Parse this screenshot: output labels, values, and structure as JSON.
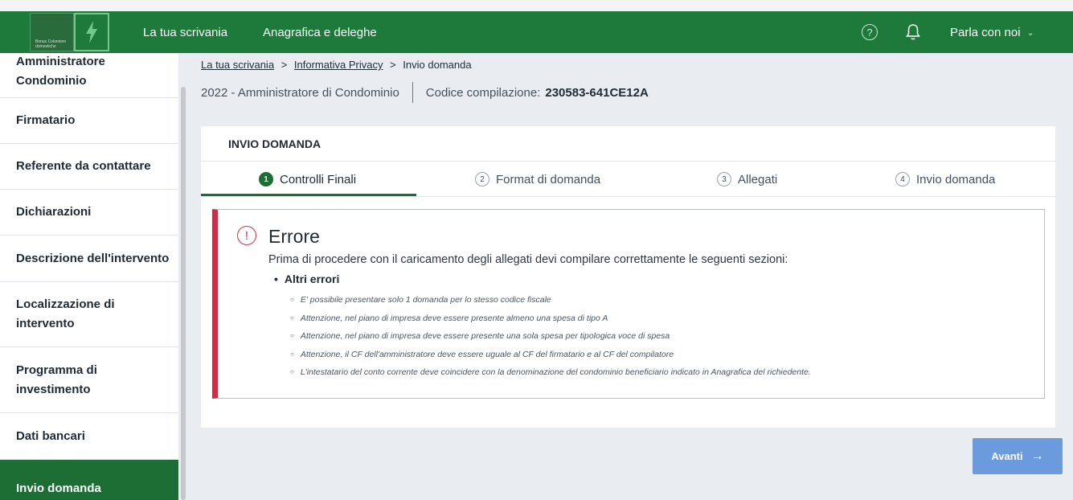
{
  "header": {
    "logo_text": "Bonus Colonnine domestiche",
    "nav": [
      "La tua scrivania",
      "Anagrafica e deleghe"
    ],
    "help_glyph": "?",
    "chat_label": "Parla con noi",
    "chat_chevron": "⌄"
  },
  "sidebar": {
    "items": [
      {
        "label": "Amministratore Condominio",
        "active": false
      },
      {
        "label": "Firmatario",
        "active": false
      },
      {
        "label": "Referente da contattare",
        "active": false
      },
      {
        "label": "Dichiarazioni",
        "active": false
      },
      {
        "label": "Descrizione dell'intervento",
        "active": false
      },
      {
        "label": "Localizzazione di intervento",
        "active": false
      },
      {
        "label": "Programma di investimento",
        "active": false
      },
      {
        "label": "Dati bancari",
        "active": false
      },
      {
        "label": "Invio domanda",
        "active": true
      }
    ]
  },
  "breadcrumb": {
    "items": [
      "La tua scrivania",
      "Informativa Privacy",
      "Invio domanda"
    ],
    "separator": ">"
  },
  "subheader": {
    "year_role": "2022 - Amministratore di Condominio",
    "code_label": "Codice compilazione:",
    "code_value": "230583-641CE12A"
  },
  "card": {
    "title": "INVIO DOMANDA",
    "steps": [
      {
        "num": "1",
        "label": "Controlli Finali",
        "active": true
      },
      {
        "num": "2",
        "label": "Format di domanda",
        "active": false
      },
      {
        "num": "3",
        "label": "Allegati",
        "active": false
      },
      {
        "num": "4",
        "label": "Invio domanda",
        "active": false
      }
    ]
  },
  "error": {
    "icon_glyph": "!",
    "title": "Errore",
    "description": "Prima di procedere con il caricamento degli allegati devi compilare correttamente le seguenti sezioni:",
    "section": "Altri errori",
    "items": [
      "E' possibile presentare solo 1 domanda per lo stesso codice fiscale",
      "Attenzione, nel piano di impresa deve essere presente almeno una spesa di tipo A",
      "Attenzione, nel piano di impresa deve essere presente una sola spesa per tipologica voce di spesa",
      "Attenzione, il CF dell'amministratore deve essere uguale al CF del firmatario e al CF del compilatore",
      "L'intestatario del conto corrente deve coincidere con la denominazione del condominio beneficiario indicato in Anagrafica del richiedente."
    ]
  },
  "footer": {
    "next_label": "Avanti",
    "next_arrow": "→"
  },
  "colors": {
    "brand_green": "#1d7a3a",
    "active_green": "#1d6e35",
    "error_red": "#c6314a",
    "button_blue": "#6b9bdd"
  }
}
